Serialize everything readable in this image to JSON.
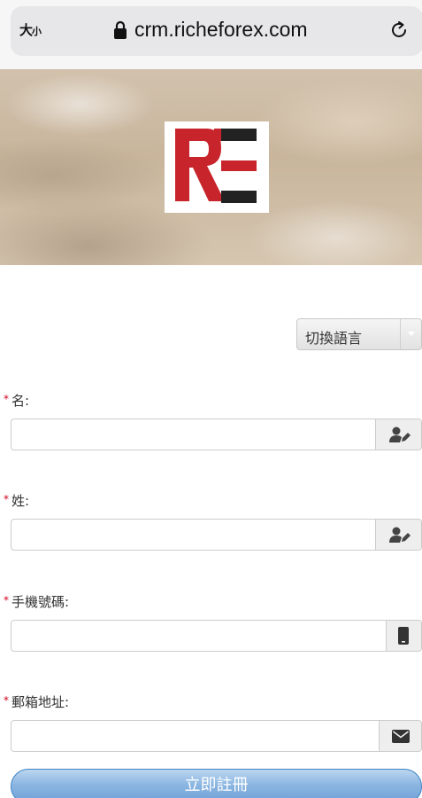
{
  "browser": {
    "text_size_label_big": "大",
    "text_size_label_small": "小",
    "url": "crm.richeforex.com"
  },
  "language": {
    "select_label": "切換語言"
  },
  "form": {
    "first_name_label": "名:",
    "last_name_label": "姓:",
    "phone_label": "手機號碼:",
    "email_label": "郵箱地址:",
    "required_mark": "*",
    "first_name_value": "",
    "last_name_value": "",
    "phone_value": "",
    "email_value": ""
  },
  "submit": {
    "label": "立即註冊"
  },
  "colors": {
    "logo_red": "#c8242b",
    "logo_black": "#222222",
    "required_star": "#d0021b",
    "button_blue": "#6f9fd5"
  }
}
